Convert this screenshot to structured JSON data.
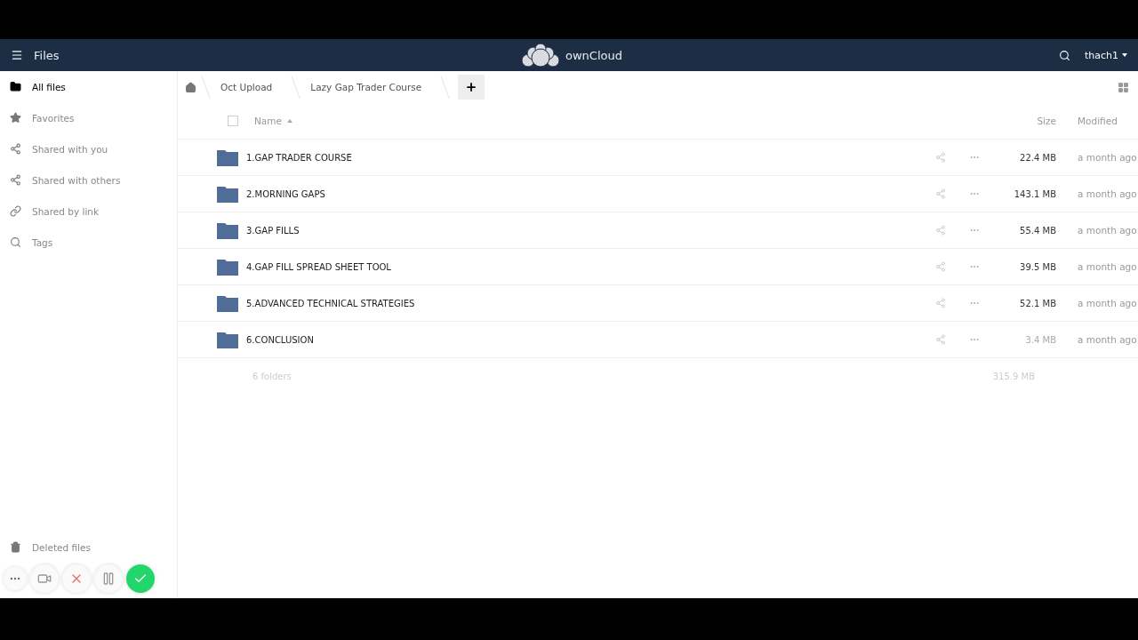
{
  "header": {
    "menu_label": "Files",
    "brand": "ownCloud",
    "user": "thach1"
  },
  "sidebar": {
    "items": [
      {
        "kind": "folder",
        "label": "All files",
        "selected": true
      },
      {
        "kind": "star",
        "label": "Favorites",
        "selected": false
      },
      {
        "kind": "share",
        "label": "Shared with you",
        "selected": false
      },
      {
        "kind": "share",
        "label": "Shared with others",
        "selected": false
      },
      {
        "kind": "link",
        "label": "Shared by link",
        "selected": false
      },
      {
        "kind": "tag",
        "label": "Tags",
        "selected": false
      }
    ],
    "footer": {
      "label": "Deleted files"
    }
  },
  "breadcrumbs": [
    "Oct Upload",
    "Lazy Gap Trader Course"
  ],
  "table": {
    "columns": [
      "Name",
      "Size",
      "Modified"
    ],
    "select_all": {
      "checked": false
    },
    "rows": [
      {
        "name": "1.GAP TRADER COURSE",
        "size": "22.4 MB",
        "modified": "a month ago",
        "faded": false
      },
      {
        "name": "2.MORNING GAPS",
        "size": "143.1 MB",
        "modified": "a month ago",
        "faded": false
      },
      {
        "name": "3.GAP FILLS",
        "size": "55.4 MB",
        "modified": "a month ago",
        "faded": false
      },
      {
        "name": "4.GAP FILL SPREAD SHEET TOOL",
        "size": "39.5 MB",
        "modified": "a month ago",
        "faded": false
      },
      {
        "name": "5.ADVANCED TECHNICAL STRATEGIES",
        "size": "52.1 MB",
        "modified": "a month ago",
        "faded": false
      },
      {
        "name": "6.CONCLUSION",
        "size": "3.4 MB",
        "modified": "a month ago",
        "faded": true
      }
    ],
    "summary": {
      "count": "6 folders",
      "total": "315.9 MB"
    }
  },
  "recorder": [
    {
      "kind": "more"
    },
    {
      "kind": "camera"
    },
    {
      "kind": "cancel"
    },
    {
      "kind": "pause"
    },
    {
      "kind": "done"
    }
  ]
}
